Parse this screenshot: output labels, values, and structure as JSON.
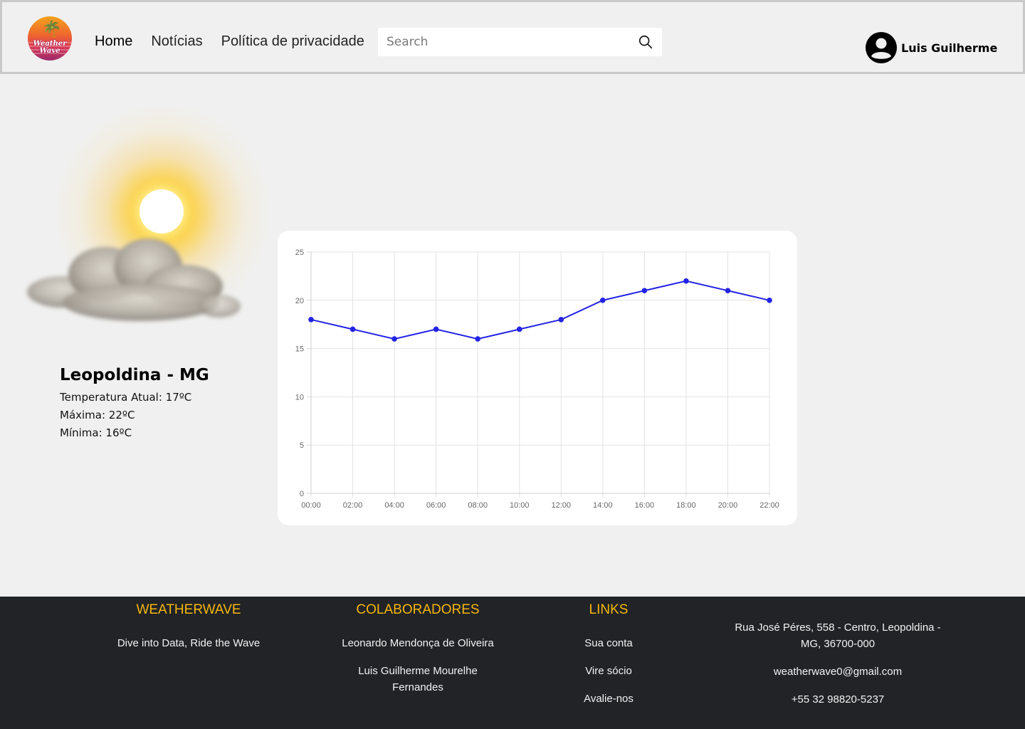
{
  "header": {
    "logo_text_line1": "Weather",
    "logo_text_line2": "Wave",
    "nav": [
      {
        "label": "Home"
      },
      {
        "label": "Notícias"
      },
      {
        "label": "Política de privacidade"
      }
    ],
    "search": {
      "placeholder": "Search",
      "value": ""
    },
    "user": {
      "name": "Luis Guilherme"
    }
  },
  "weather": {
    "city": "Leopoldina - MG",
    "current": "Temperatura Atual: 17ºC",
    "max": "Máxima: 22ºC",
    "min": "Mínima: 16ºC"
  },
  "chart_data": {
    "type": "line",
    "x": [
      "00:00",
      "02:00",
      "04:00",
      "06:00",
      "08:00",
      "10:00",
      "12:00",
      "14:00",
      "16:00",
      "18:00",
      "20:00",
      "22:00"
    ],
    "series": [
      {
        "values": [
          18,
          17,
          16,
          17,
          16,
          17,
          18,
          20,
          21,
          22,
          21,
          20
        ],
        "color": "#2323e6"
      }
    ],
    "yticks": [
      "0",
      "5",
      "10",
      "15",
      "20",
      "25"
    ],
    "ylim": [
      0,
      25
    ],
    "grid": true,
    "title": "",
    "xlabel": "",
    "ylabel": ""
  },
  "footer": {
    "brand": {
      "title": "WEATHERWAVE",
      "tagline": "Dive into Data, Ride the Wave"
    },
    "collaborators": {
      "title": "COLABORADORES",
      "names": [
        "Leonardo Mendonça de Oliveira",
        "Luis Guilherme Mourelhe Fernandes"
      ]
    },
    "links": {
      "title": "LINKS",
      "items": [
        "Sua conta",
        "Vire sócio",
        "Avalie-nos"
      ]
    },
    "contact": {
      "address": "Rua José Péres, 558 - Centro, Leopoldina - MG, 36700-000",
      "email": "weatherwave0@gmail.com",
      "phone": "+55 32 98820-5237"
    },
    "colors": {
      "background": "#212327",
      "heading": "#f5b70a"
    }
  }
}
